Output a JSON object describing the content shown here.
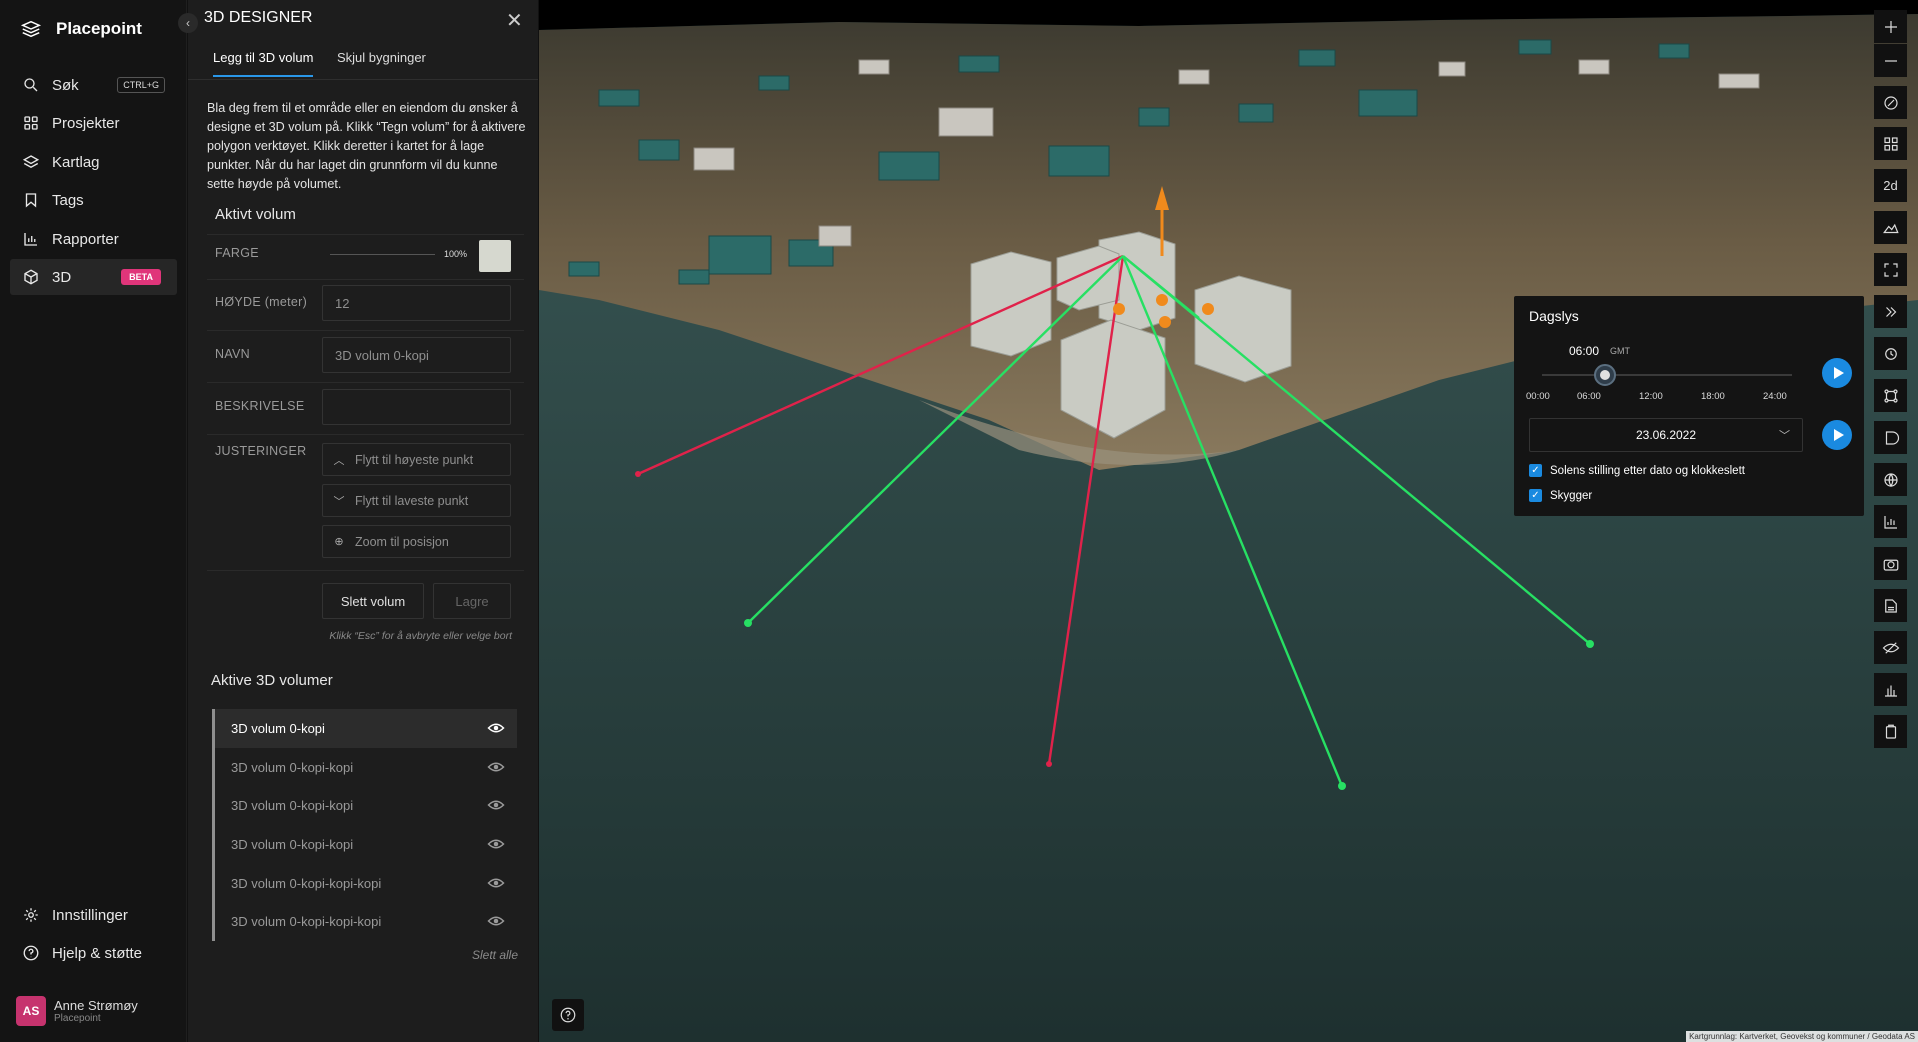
{
  "app": {
    "brand": "Placepoint"
  },
  "nav": {
    "items": [
      {
        "label": "Søk",
        "shortcut": "CTRL+G",
        "icon": "search-icon"
      },
      {
        "label": "Prosjekter",
        "icon": "grid-icon"
      },
      {
        "label": "Kartlag",
        "icon": "layers-icon"
      },
      {
        "label": "Tags",
        "icon": "bookmark-icon"
      },
      {
        "label": "Rapporter",
        "icon": "bar-chart-icon"
      },
      {
        "label": "3D",
        "badge": "BETA",
        "icon": "cube-icon",
        "active": true
      }
    ],
    "bottom": [
      {
        "label": "Innstillinger",
        "icon": "gear-icon"
      },
      {
        "label": "Hjelp & støtte",
        "icon": "help-icon"
      }
    ],
    "user": {
      "initials": "AS",
      "name": "Anne Strømøy",
      "org": "Placepoint"
    }
  },
  "designer": {
    "title": "3D DESIGNER",
    "tabs": [
      "Legg til 3D volum",
      "Skjul bygninger"
    ],
    "intro": "Bla deg frem til et område eller en eiendom du ønsker å designe et 3D volum på. Klikk “Tegn volum” for å aktivere polygon verktøyet. Klikk deretter i kartet for å lage punkter. Når du har laget din grunnform vil du kunne sette høyde på volumet.",
    "active_title": "Aktivt volum",
    "labels": {
      "color": "FARGE",
      "height": "HØYDE (meter)",
      "name": "NAVN",
      "description": "BESKRIVELSE",
      "adjustments": "JUSTERINGER"
    },
    "opacity": "100%",
    "swatch_color": "#d6d8cf",
    "height_value": "12",
    "name_value": "3D volum 0-kopi",
    "description_value": "",
    "adjustments": [
      "Flytt til høyeste punkt",
      "Flytt til laveste punkt",
      "Zoom til posisjon"
    ],
    "delete_label": "Slett volum",
    "save_label": "Lagre",
    "hint": "Klikk “Esc” for å avbryte eller velge bort",
    "list_title": "Aktive 3D volumer",
    "volumes": [
      "3D volum 0-kopi",
      "3D volum 0-kopi-kopi",
      "3D volum 0-kopi-kopi",
      "3D volum 0-kopi-kopi",
      "3D volum 0-kopi-kopi-kopi",
      "3D volum 0-kopi-kopi-kopi"
    ],
    "delete_all": "Slett alle"
  },
  "toolbar": {
    "twod_label": "2d",
    "icons": [
      "zoom-in-icon",
      "zoom-out-icon",
      "compass-icon",
      "qr-icon",
      "2d-toggle",
      "terrain-icon",
      "fullscreen-icon",
      "expand-icon",
      "measure-icon",
      "nodes-icon",
      "shape-icon",
      "globe-icon",
      "chart-icon",
      "camera-icon",
      "print-icon",
      "visibility-icon",
      "elevation-icon",
      "clipboard-icon"
    ]
  },
  "daylight": {
    "title": "Dagslys",
    "time": "06:00",
    "timezone": "GMT",
    "ticks": [
      "00:00",
      "06:00",
      "12:00",
      "18:00",
      "24:00"
    ],
    "time_fraction": 0.25,
    "date": "23.06.2022",
    "check_sun": "Solens stilling etter dato og klokkeslett",
    "check_shadows": "Skygger"
  },
  "map": {
    "attribution": "Kartgrunnlag: Kartverket, Geovekst og kommuner / Geodata AS"
  }
}
